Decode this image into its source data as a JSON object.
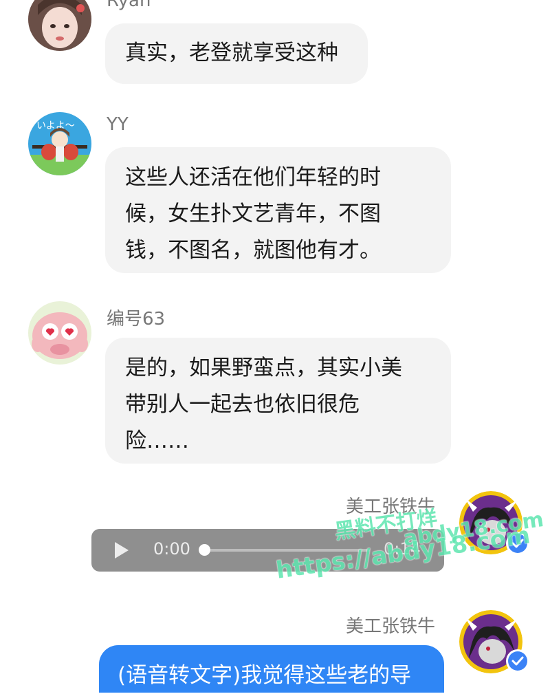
{
  "messages": [
    {
      "sender": "Ryan",
      "text": "真实，老登就享受这种"
    },
    {
      "sender": "YY",
      "lines": [
        "这些人还活在他们年轻的时",
        "候，女生扑文艺青年，不图",
        "钱，不图名，就图他有才。"
      ]
    },
    {
      "sender": "编号63",
      "lines": [
        "是的，如果野蛮点，其实小美",
        "带别人一起去也依旧很危",
        "险……"
      ]
    },
    {
      "sender": "美工张铁牛",
      "audio": {
        "current": "0:00",
        "duration": "0:14",
        "progress": 0.0
      }
    },
    {
      "sender": "美工张铁牛",
      "text": "(语音转文字)我觉得这些老的导"
    }
  ],
  "watermark": {
    "line1": "黑料不打烊",
    "line2": "abdy18.com",
    "line3": "https://abdy18.com"
  },
  "colors": {
    "bubble": "#f3f3f3",
    "bubble_self": "#2f86f5",
    "audio_bg": "#8f8f8f",
    "verified": "#3b82f6",
    "watermark": "#5fe6b0"
  }
}
